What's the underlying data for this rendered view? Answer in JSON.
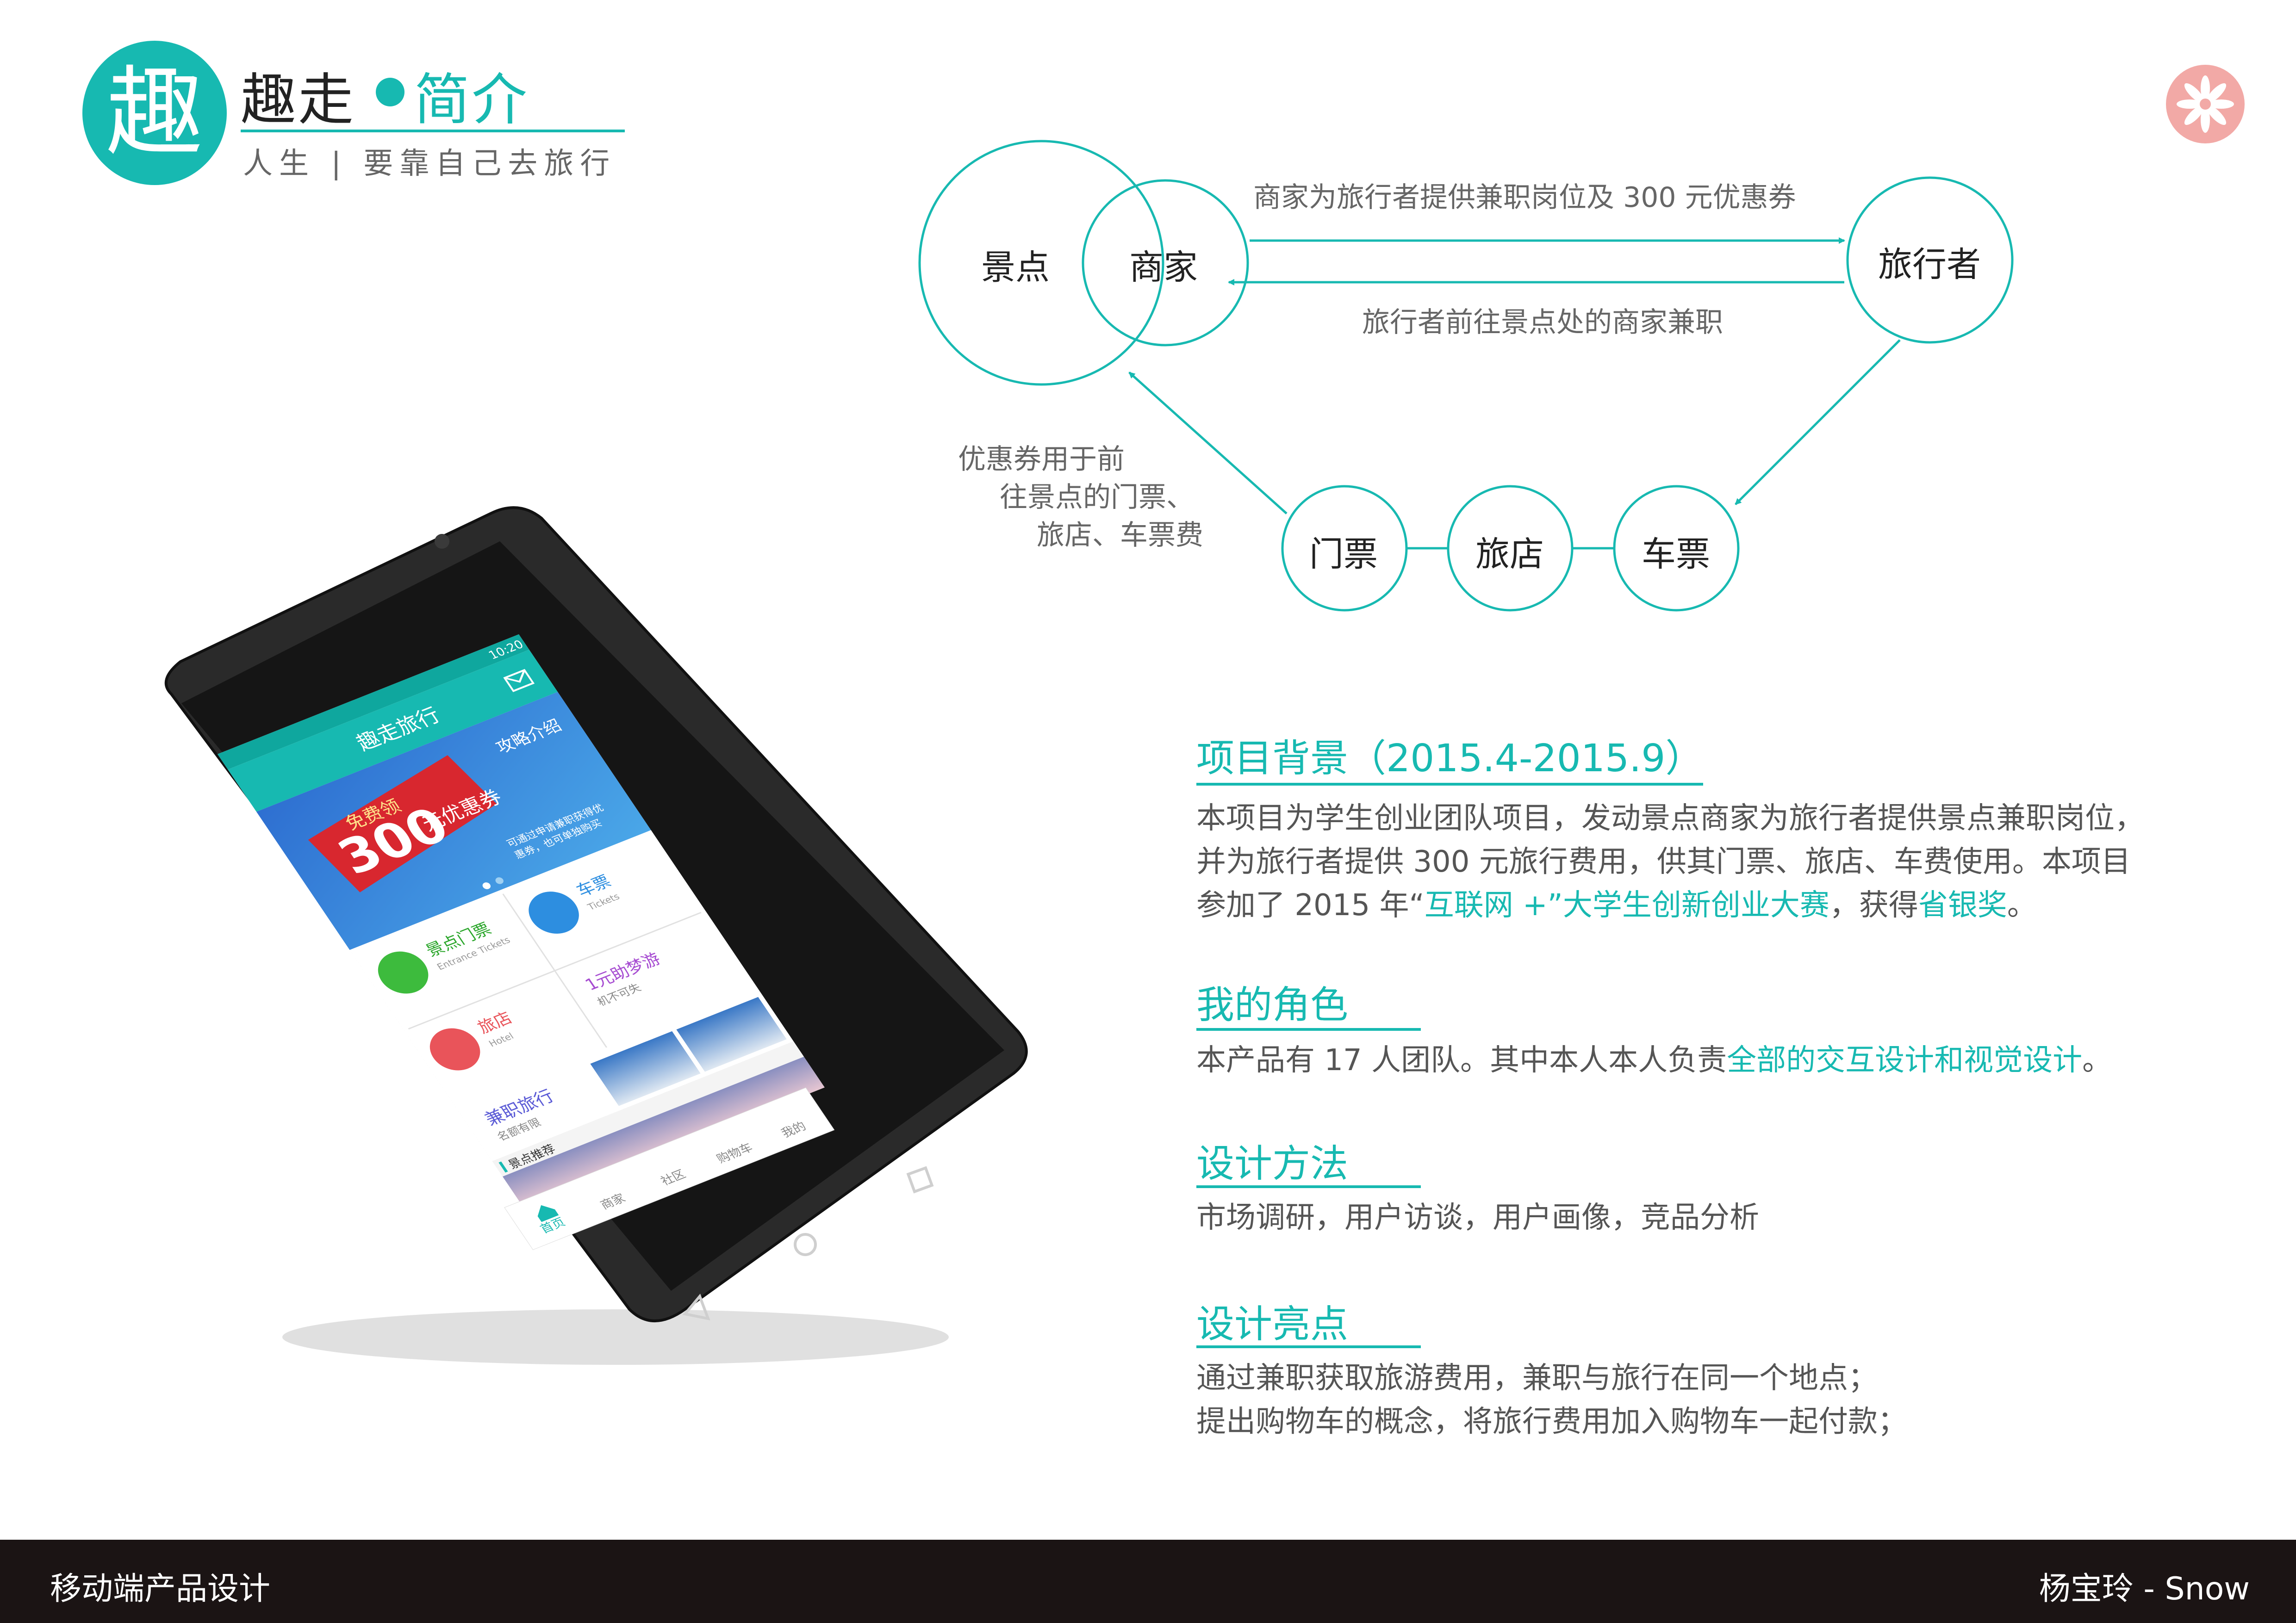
{
  "header": {
    "logo_char": "趣",
    "title_main": "趣走",
    "title_sub": "简介",
    "tagline": "人生 | 要靠自己去旅行"
  },
  "diagram": {
    "nodes": {
      "scenic": "景点",
      "merchant": "商家",
      "traveler": "旅行者",
      "ticket": "门票",
      "hotel": "旅店",
      "train_ticket": "车票"
    },
    "edge_top": "商家为旅行者提供兼职岗位及 300 元优惠券",
    "edge_bottom": "旅行者前往景点处的商家兼职",
    "coupon_lines": [
      "优惠券用于前",
      "往景点的门票、",
      "旅店、车票费"
    ]
  },
  "sections": {
    "background": {
      "title": "项目背景（2015.4-2015.9）",
      "lines": [
        "本项目为学生创业团队项目，发动景点商家为旅行者提供景点兼职岗位，",
        "并为旅行者提供 300 元旅行费用，供其门票、旅店、车费使用。本项目"
      ],
      "line3_prefix": "参加了 2015 年“",
      "line3_hl1": "互联网 +”大学生创新创业大赛",
      "line3_mid": "，获得",
      "line3_hl2": "省银奖",
      "line3_suffix": "。"
    },
    "role": {
      "title": "我的角色",
      "prefix": "本产品有 17 人团队。其中本人本人负责",
      "highlight": "全部的交互设计和视觉设计",
      "suffix": "。"
    },
    "method": {
      "title": "设计方法",
      "text": "市场调研，用户访谈，用户画像，竞品分析"
    },
    "highlight": {
      "title": "设计亮点",
      "lines": [
        "通过兼职获取旅游费用，兼职与旅行在同一个地点；",
        "提出购物车的概念，将旅行费用加入购物车一起付款；"
      ]
    }
  },
  "footer": {
    "left": "移动端产品设计",
    "right": "杨宝玲 - Snow"
  },
  "phone": {
    "status_time": "10:20",
    "app_title": "趣走旅行",
    "banner_top": "免费领",
    "banner_big": "300",
    "banner_rest": "元优惠券",
    "banner_side": "攻略介绍",
    "banner_desc_1": "可通过申请兼职获得优",
    "banner_desc_2": "惠券，也可单独购买",
    "grid": {
      "tickets_cn": "景点门票",
      "tickets_en": "Entrance Tickets",
      "train_cn": "车票",
      "train_en": "Tickets",
      "hotel_cn": "旅店",
      "hotel_en": "Hotel",
      "dream_cn": "1元助梦游",
      "dream_sub": "机不可失",
      "parttime_cn": "兼职旅行",
      "parttime_sub": "名额有限"
    },
    "recommend": "景点推荐",
    "tabs": [
      "首页",
      "商家",
      "社区",
      "购物车",
      "我的"
    ]
  },
  "colors": {
    "accent": "#17b9b1",
    "footer_bg": "#1b1414",
    "badge_pink": "#f2a9a6"
  }
}
